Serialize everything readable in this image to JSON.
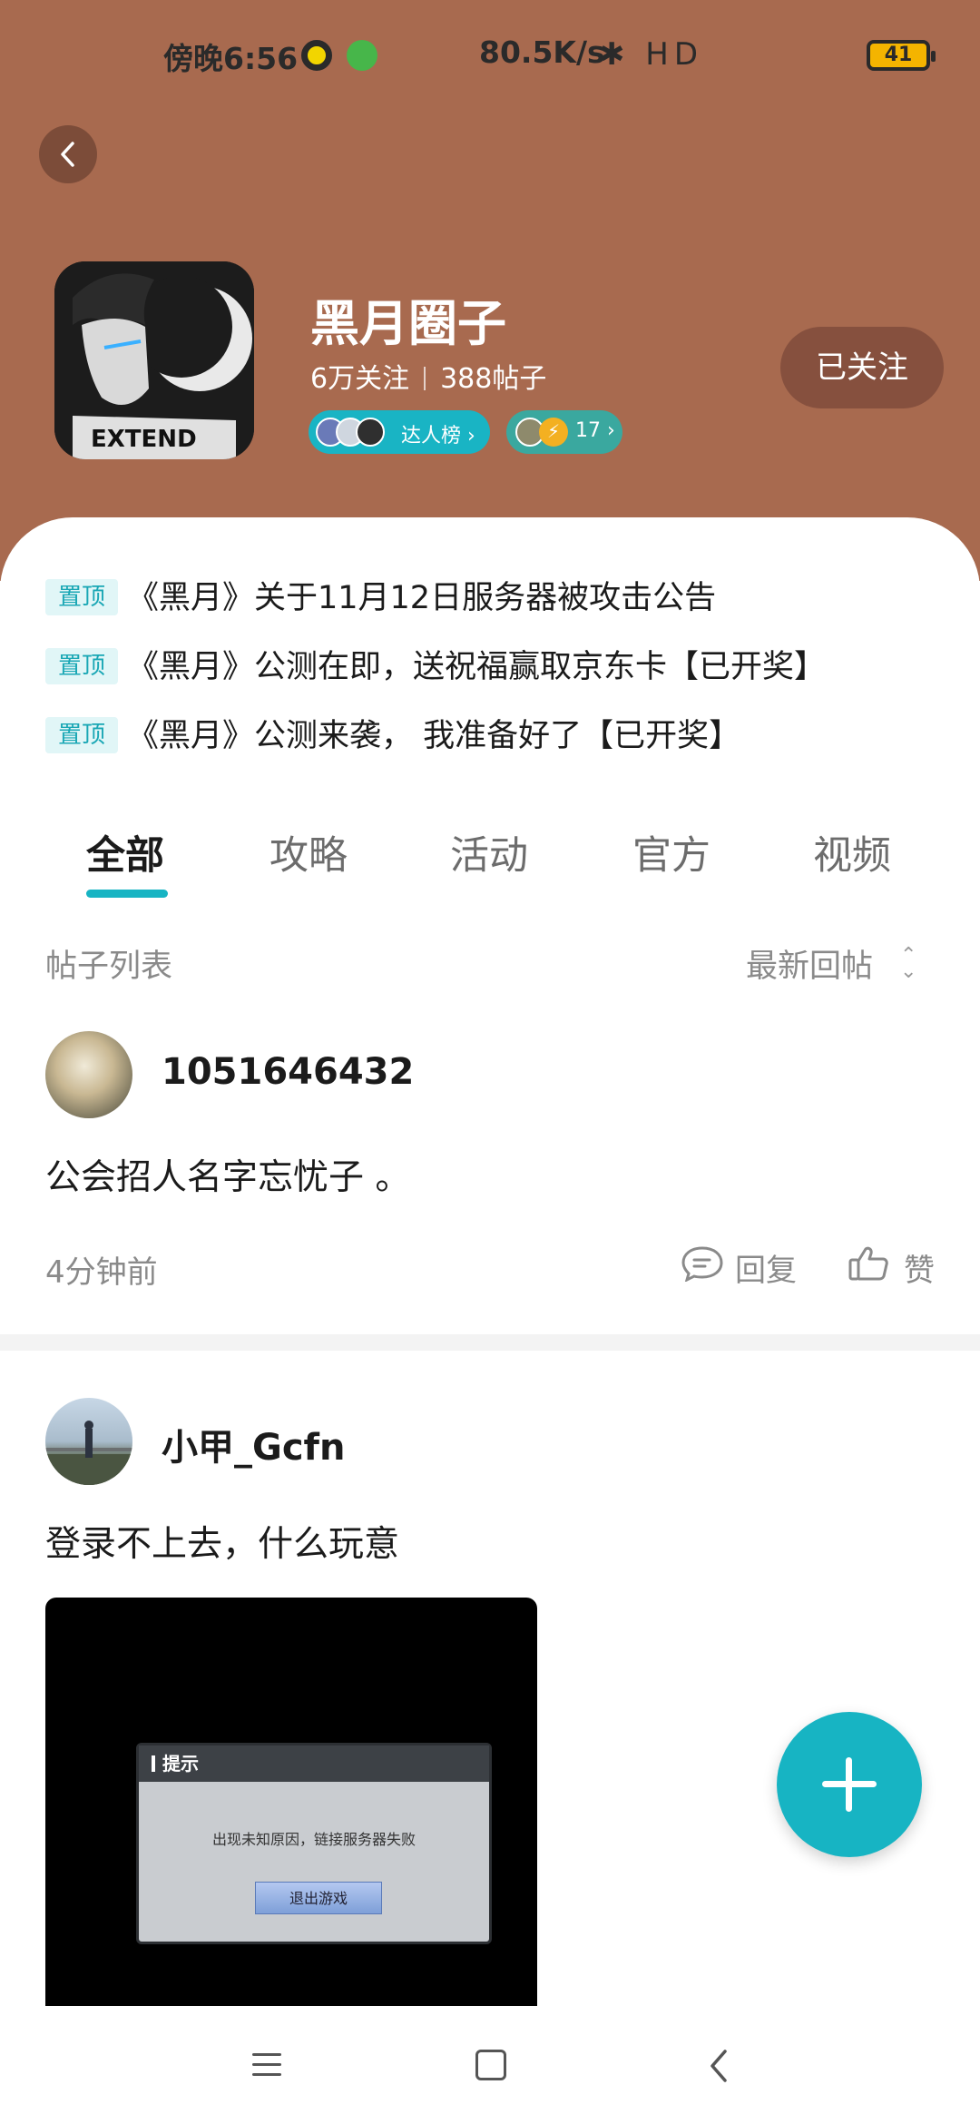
{
  "status_bar": {
    "time": "傍晚6:56",
    "network_speed": "80.5K/s",
    "icons": "✱ HD",
    "battery": "41"
  },
  "circle": {
    "name": "黑月圈子",
    "followers": "6万关注",
    "posts": "388帖子",
    "rank_label": "达人榜 ›",
    "count_label": "17 ›",
    "follow_button": "已关注"
  },
  "pinned": [
    {
      "tag": "置顶",
      "title": "《黑月》关于11月12日服务器被攻击公告"
    },
    {
      "tag": "置顶",
      "title": "《黑月》公测在即，送祝福赢取京东卡【已开奖】"
    },
    {
      "tag": "置顶",
      "title": "《黑月》公测来袭， 我准备好了【已开奖】"
    }
  ],
  "tabs": [
    "全部",
    "攻略",
    "活动",
    "官方",
    "视频"
  ],
  "list": {
    "label": "帖子列表",
    "sort": "最新回帖"
  },
  "posts": [
    {
      "username": "1051646432",
      "content": "公会招人名字忘忧子   。",
      "time": "4分钟前",
      "reply": "回复",
      "like": "赞"
    },
    {
      "username": "小甲_Gcfn",
      "content": "登录不上去，什么玩意",
      "image": {
        "dialog_title": "提示",
        "dialog_message": "出现未知原因，链接服务器失败",
        "dialog_button": "退出游戏"
      }
    }
  ],
  "colors": {
    "header": "#a86a4f",
    "accent": "#17b4c3"
  }
}
